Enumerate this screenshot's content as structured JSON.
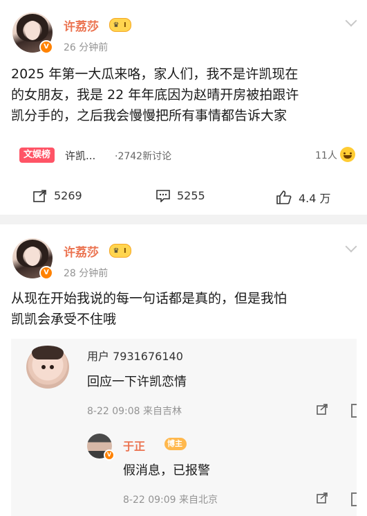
{
  "post1": {
    "username": "许荔莎",
    "level": "I",
    "time": "26 分钟前",
    "text_lines": [
      "2025 年第一大瓜来咯，家人们，我不是许凯现在",
      "的女朋友，我是 22 年年底因为赵晴开房被拍跟许",
      "凯分手的，之后我会慢慢把所有事情都告诉大家"
    ],
    "topic_tag": "文娱榜",
    "topic_name": "许凯...",
    "topic_discussion": "·2742新讨论",
    "people": "11人",
    "actions": {
      "repost": "5269",
      "comment": "5255",
      "like": "4.4 万"
    }
  },
  "post2": {
    "username": "许荔莎",
    "level": "I",
    "time": "28 分钟前",
    "text_lines": [
      "从现在开始我说的每一句话都是真的，但是我怕",
      "凯凯会承受不住哦"
    ],
    "comment1": {
      "user": "用户 7931676140",
      "text": "回应一下许凯恋情",
      "meta": "8-22 09:08 来自吉林"
    },
    "reply": {
      "user": "于正",
      "badge": "博主",
      "text": "假消息，已报警",
      "meta": "8-22 09:09 来自北京"
    }
  },
  "colors": {
    "username": "#eb7350",
    "muted": "#939393",
    "tag": "#ff5466",
    "verified": "#ff8200"
  },
  "icons": [
    "chevron-down-icon",
    "verified-icon",
    "crown-icon",
    "repost-icon",
    "comment-icon",
    "like-icon",
    "share-icon",
    "laugh-emoji-icon"
  ]
}
